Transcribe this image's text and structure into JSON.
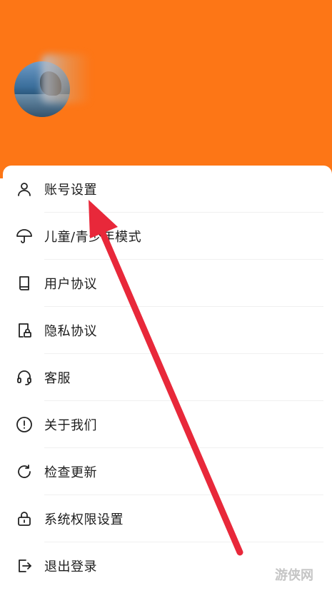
{
  "profile": {
    "avatar": "avatar-photo"
  },
  "menu": [
    {
      "icon": "user-icon",
      "label": "账号设置"
    },
    {
      "icon": "umbrella-icon",
      "label": "儿童/青少年模式"
    },
    {
      "icon": "book-icon",
      "label": "用户协议"
    },
    {
      "icon": "privacy-lock-icon",
      "label": "隐私协议"
    },
    {
      "icon": "headset-icon",
      "label": "客服"
    },
    {
      "icon": "info-icon",
      "label": "关于我们"
    },
    {
      "icon": "refresh-icon",
      "label": "检查更新"
    },
    {
      "icon": "lock-icon",
      "label": "系统权限设置"
    },
    {
      "icon": "logout-icon",
      "label": "退出登录"
    }
  ],
  "colors": {
    "header": "#fd7616",
    "arrow": "#e8283a"
  },
  "watermark": "游侠网"
}
